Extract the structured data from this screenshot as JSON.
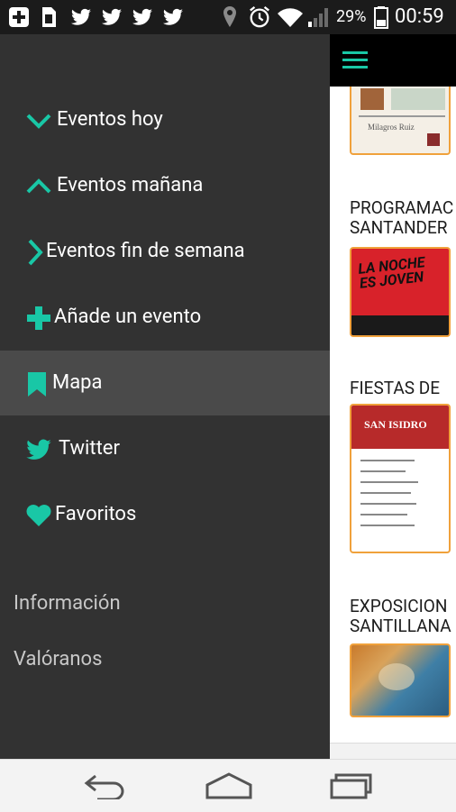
{
  "colors": {
    "accent": "#19c7a6",
    "drawer_bg": "#323232",
    "drawer_active_bg": "#4a4a4a",
    "thumb_border": "#f0a13b"
  },
  "status_bar": {
    "battery_percent": "29%",
    "time": "00:59"
  },
  "drawer": {
    "items": [
      {
        "label": "Eventos hoy",
        "icon": "chevron-down-icon"
      },
      {
        "label": "Eventos mañana",
        "icon": "chevron-up-icon"
      },
      {
        "label": "Eventos fin de semana",
        "icon": "chevron-right-icon"
      },
      {
        "label": "Añade un evento",
        "icon": "plus-icon"
      },
      {
        "label": "Mapa",
        "icon": "bookmark-icon",
        "active": true
      },
      {
        "label": "Twitter",
        "icon": "twitter-icon"
      },
      {
        "label": "Favoritos",
        "icon": "heart-icon"
      }
    ],
    "secondary": [
      {
        "label": "Información"
      },
      {
        "label": "Valóranos"
      }
    ]
  },
  "events": [
    {
      "title_lines": [
        "",
        ""
      ],
      "thumb_caption": "Milagros Ruiz"
    },
    {
      "title_lines": [
        "PROGRAMAC",
        "SANTANDER"
      ],
      "thumb_caption": "LA NOCHE ES JOVEN"
    },
    {
      "title_lines": [
        "FIESTAS DE",
        ""
      ],
      "thumb_caption": "SAN ISIDRO"
    },
    {
      "title_lines": [
        "EXPOSICION",
        "SANTILLANA"
      ],
      "thumb_caption": ""
    }
  ]
}
